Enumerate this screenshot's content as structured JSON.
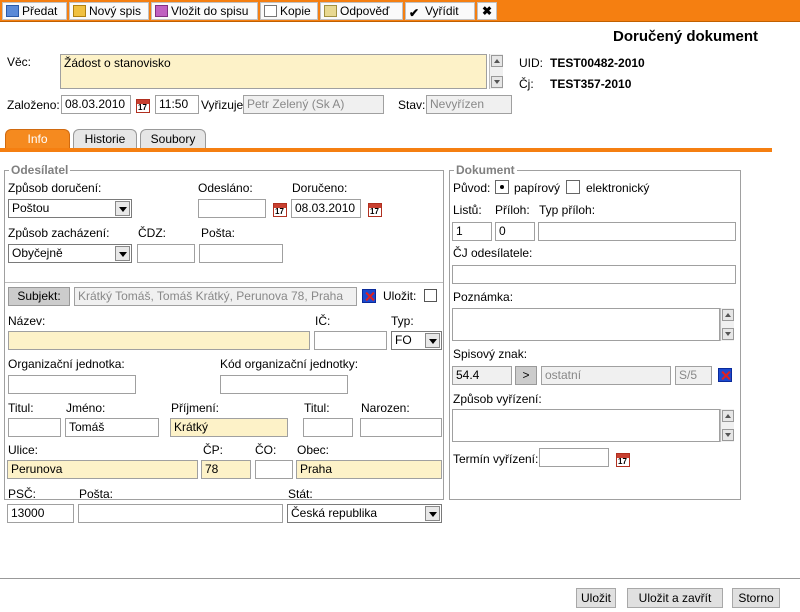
{
  "toolbar": {
    "predat": "Předat",
    "novy_spis": "Nový spis",
    "vlozit": "Vložit do spisu",
    "kopie": "Kopie",
    "odpoved": "Odpověď",
    "vyridit": "Vyřídit"
  },
  "page_title": "Doručený dokument",
  "header": {
    "vec_label": "Věc:",
    "vec_value": "Žádost o stanovisko",
    "uid_label": "UID:",
    "uid_value": "TEST00482-2010",
    "cj_label": "Čj:",
    "cj_value": "TEST357-2010",
    "zalozeno_label": "Založeno:",
    "zalozeno_date": "08.03.2010",
    "zalozeno_time": "11:50",
    "vyrizuje_label": "Vyřizuje:",
    "vyrizuje_value": "Petr Zelený (Sk A)",
    "stav_label": "Stav:",
    "stav_value": "Nevyřízen"
  },
  "tabs": [
    "Info",
    "Historie",
    "Soubory"
  ],
  "odesilatel": {
    "legend": "Odesílatel",
    "zpusob_doruceni_label": "Způsob doručení:",
    "zpusob_doruceni_value": "Poštou",
    "odeslano_label": "Odesláno:",
    "odeslano_value": "",
    "doruceno_label": "Doručeno:",
    "doruceno_value": "08.03.2010",
    "zpusob_zachazeni_label": "Způsob zacházení:",
    "zpusob_zachazeni_value": "Obyčejně",
    "cdz_label": "ČDZ:",
    "posta_label": "Pošta:",
    "subjekt_button": "Subjekt:",
    "subjekt_value": "Krátký Tomáš, Tomáš Krátký, Perunova 78, Praha",
    "ulozit_label": "Uložit:",
    "nazev_label": "Název:",
    "ic_label": "IČ:",
    "typ_label": "Typ:",
    "typ_value": "FO",
    "org_jednotka_label": "Organizační jednotka:",
    "kod_org_label": "Kód organizační jednotky:",
    "titul_label": "Titul:",
    "jmeno_label": "Jméno:",
    "jmeno_value": "Tomáš",
    "prijmeni_label": "Příjmení:",
    "prijmeni_value": "Krátký",
    "titul2_label": "Titul:",
    "narozen_label": "Narozen:",
    "ulice_label": "Ulice:",
    "ulice_value": "Perunova",
    "cp_label": "ČP:",
    "cp_value": "78",
    "co_label": "ČO:",
    "obec_label": "Obec:",
    "obec_value": "Praha",
    "psc_label": "PSČ:",
    "psc_value": "13000",
    "posta2_label": "Pošta:",
    "stat_label": "Stát:",
    "stat_value": "Česká republika"
  },
  "dokument": {
    "legend": "Dokument",
    "puvod_label": "Původ:",
    "papirovy": "papírový",
    "elektronicky": "elektronický",
    "listu_label": "Listů:",
    "listu_value": "1",
    "priloh_label": "Příloh:",
    "priloh_value": "0",
    "typ_priloh_label": "Typ příloh:",
    "cj_odesilatele_label": "ČJ odesílatele:",
    "poznamka_label": "Poznámka:",
    "spisovy_znak_label": "Spisový znak:",
    "spisovy_znak_value": "54.4",
    "arrow_button": ">",
    "spisovy_znak_text": "ostatní",
    "spisovy_znak_code": "S/5",
    "zpusob_vyrizeni_label": "Způsob vyřízení:",
    "termin_label": "Termín vyřízení:"
  },
  "footer": {
    "ulozit": "Uložit",
    "ulozit_zavrit": "Uložit a zavřít",
    "storno": "Storno"
  },
  "colors": {
    "accent": "#f57f11",
    "field_highlight": "#fdf2c8"
  }
}
